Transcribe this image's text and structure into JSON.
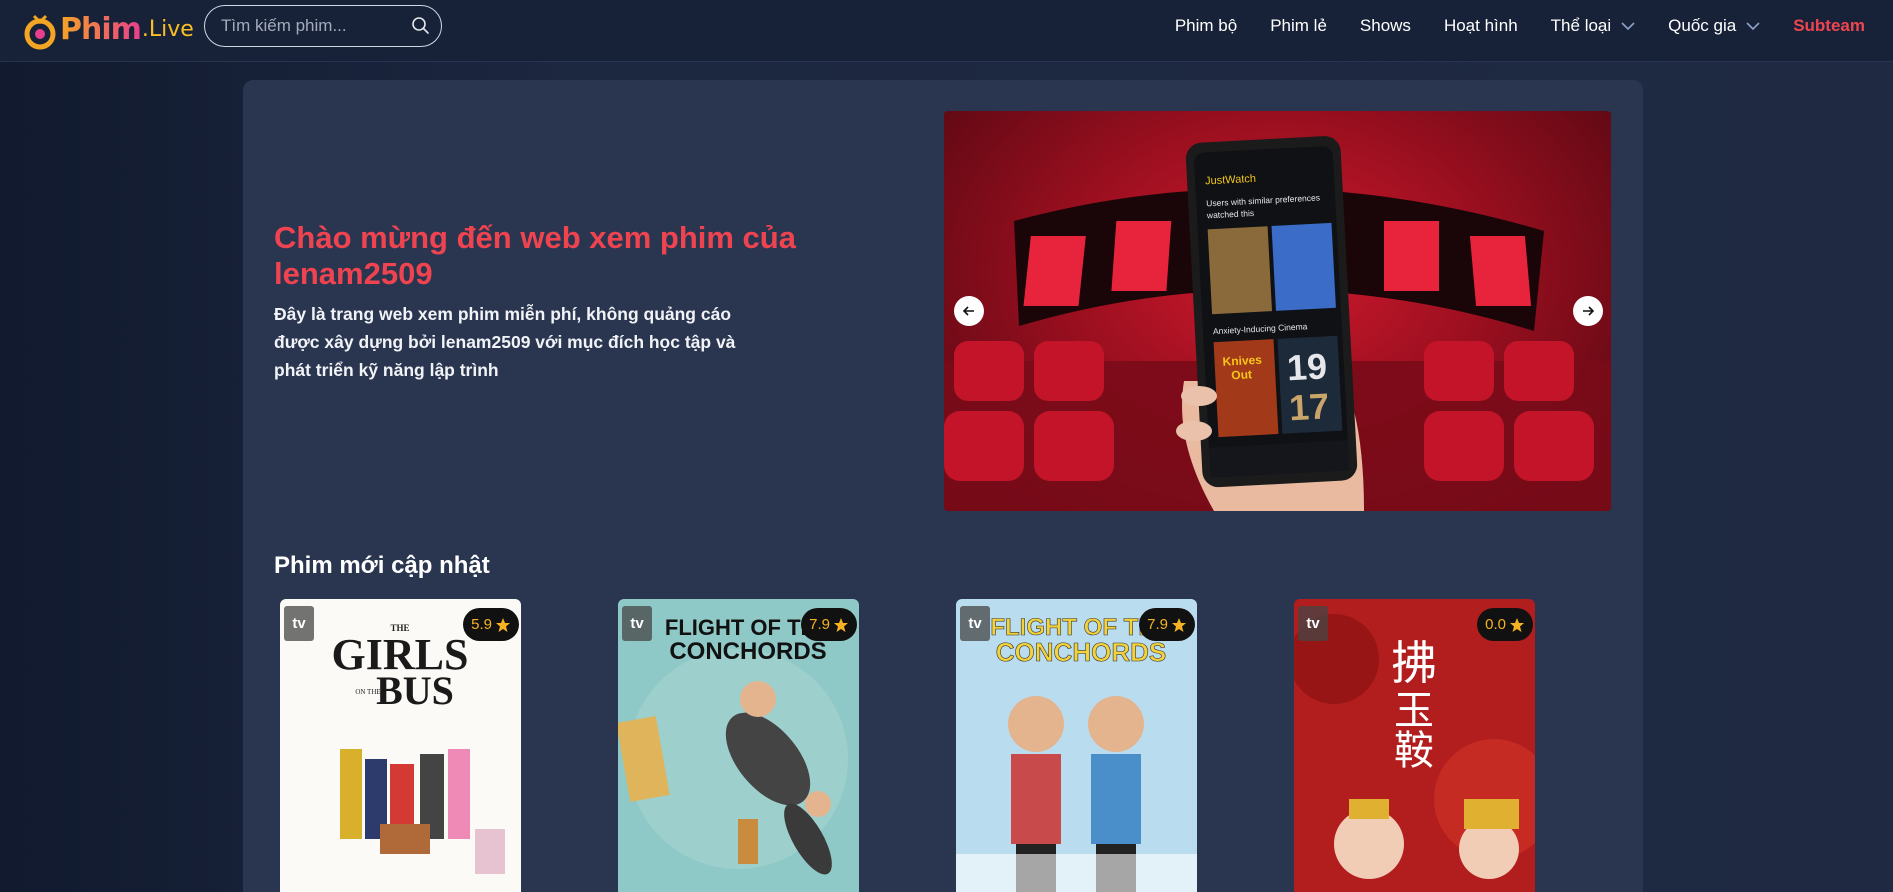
{
  "header": {
    "logo": {
      "main": "Phim",
      "sub": ".Live"
    },
    "search": {
      "placeholder": "Tìm kiếm phim...",
      "icon": "search-icon"
    },
    "nav": [
      {
        "label": "Phim bộ"
      },
      {
        "label": "Phim lẻ"
      },
      {
        "label": "Shows"
      },
      {
        "label": "Hoạt hình"
      },
      {
        "label": "Thể loại",
        "dropdown": true
      },
      {
        "label": "Quốc gia",
        "dropdown": true
      },
      {
        "label": "Subteam",
        "accent": "#ef4450"
      }
    ]
  },
  "hero": {
    "title": "Chào mừng đến web xem phim của lenam2509",
    "description": "Đây là trang web xem phim miễn phí, không quảng cáo được xây dựng bởi lenam2509 với mục đích học tập và phát triển kỹ năng lập trình",
    "slide": {
      "app_name": "JustWatch",
      "heading": "Users with similar preferences watched this",
      "section": "Anxiety-Inducing Cinema",
      "poster_text_1": "Knives Out",
      "poster_text_2": "1917"
    }
  },
  "section": {
    "title": "Phim mới cập nhật"
  },
  "movies": [
    {
      "type": "tv",
      "rating": "5.9",
      "poster_text": "THE GIRLS ON THE BUS"
    },
    {
      "type": "tv",
      "rating": "7.9",
      "poster_text": "FLIGHT OF THE CONCHORDS"
    },
    {
      "type": "tv",
      "rating": "7.9",
      "poster_text": "FLIGHT OF THE CONCHORDS"
    },
    {
      "type": "tv",
      "rating": "0.0",
      "poster_text": "拂玉鞍"
    }
  ],
  "colors": {
    "accent": "#ef4450",
    "rating": "#f5b324",
    "panel": "#2a3650",
    "header": "#172238"
  }
}
